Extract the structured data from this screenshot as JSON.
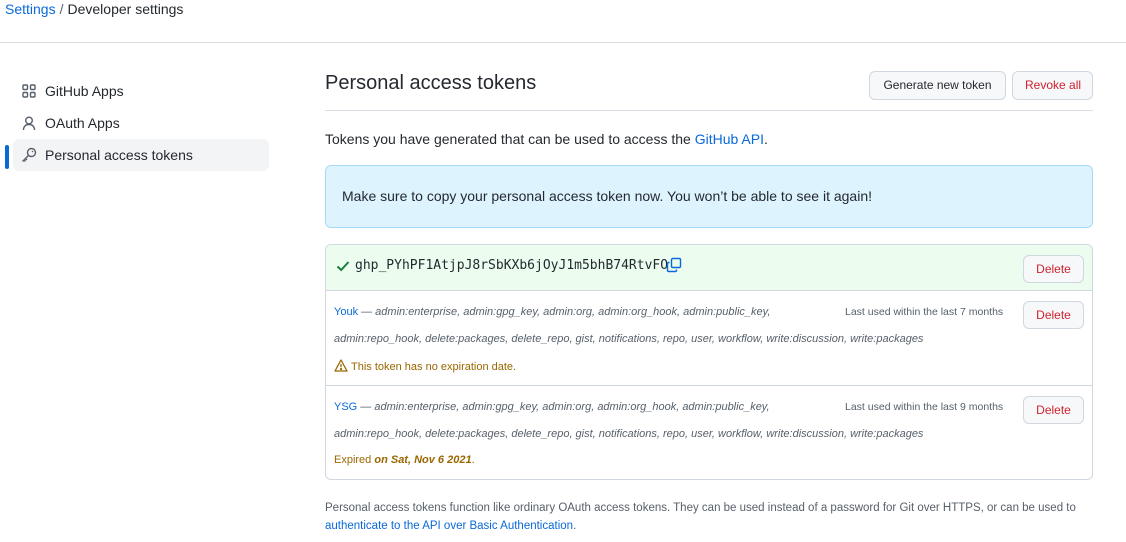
{
  "breadcrumb": {
    "link": "Settings",
    "separator": "/",
    "current": "Developer settings"
  },
  "sidebar": {
    "items": [
      {
        "label": "GitHub Apps",
        "icon": "apps-grid-icon"
      },
      {
        "label": "OAuth Apps",
        "icon": "person-icon"
      },
      {
        "label": "Personal access tokens",
        "icon": "key-icon",
        "active": true
      }
    ]
  },
  "header": {
    "title": "Personal access tokens",
    "generate_label": "Generate new token",
    "revoke_label": "Revoke all"
  },
  "intro": {
    "text": "Tokens you have generated that can be used to access the",
    "link": "GitHub API",
    "suffix": "."
  },
  "flash": {
    "message": "Make sure to copy your personal access token now. You won’t be able to see it again!"
  },
  "new_token": {
    "value": "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",
    "delete_label": "Delete"
  },
  "tokens": [
    {
      "name": "Youk",
      "scopes_line1": " — admin:enterprise, admin:gpg_key, admin:org, admin:org_hook, admin:public_key,",
      "scopes_line2": "admin:repo_hook, delete:packages, delete_repo, gist, notifications, repo, user, workflow, write:discussion, write:packages",
      "last_used": "Last used within the last 7 months",
      "note": "This token has no expiration date.",
      "delete_label": "Delete"
    },
    {
      "name": "YSG",
      "scopes_line1": " — admin:enterprise, admin:gpg_key, admin:org, admin:org_hook, admin:public_key,",
      "scopes_line2": "admin:repo_hook, delete:packages, delete_repo, gist, notifications, repo, user, workflow, write:discussion, write:packages",
      "last_used": "Last used within the last 9 months",
      "note_prefix": "Expired ",
      "note_date": "on Sat, Nov 6 2021",
      "note_suffix": ".",
      "delete_label": "Delete"
    }
  ],
  "footer": {
    "text": "Personal access tokens function like ordinary OAuth access tokens. They can be used instead of a password for Git over HTTPS, or can be used to",
    "link": "authenticate to the API over Basic Authentication",
    "suffix": "."
  },
  "colors": {
    "accent": "#0969da",
    "danger": "#cf222e",
    "success": "#1a7f37",
    "warning": "#9a6700",
    "flash_bg": "#ddf4ff"
  }
}
